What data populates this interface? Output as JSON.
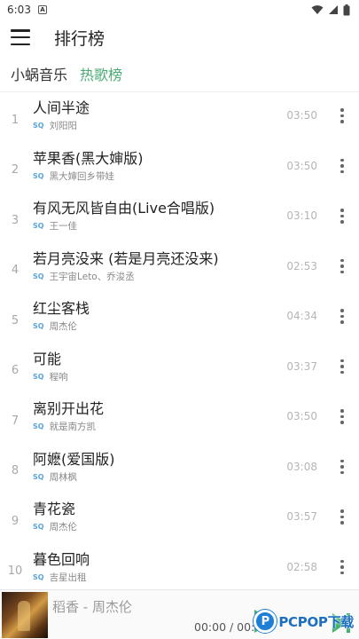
{
  "status_bar": {
    "time": "6:03",
    "notification_icon": "a-badge-icon",
    "icons": [
      "wifi-icon",
      "signal-icon",
      "battery-icon"
    ]
  },
  "app_bar": {
    "menu_icon": "menu-icon",
    "title": "排行榜"
  },
  "tabs": [
    {
      "label": "小蜗音乐",
      "active": false
    },
    {
      "label": "热歌榜",
      "active": true
    }
  ],
  "songs": [
    {
      "rank": "1",
      "title": "人间半途",
      "quality": "SQ",
      "artist": "刘阳阳",
      "duration": "03:50"
    },
    {
      "rank": "2",
      "title": "苹果香(黑大婶版)",
      "quality": "SQ",
      "artist": "黑大婶回乡带娃",
      "duration": "03:50"
    },
    {
      "rank": "3",
      "title": "有风无风皆自由(Live合唱版)",
      "quality": "SQ",
      "artist": "王一佳",
      "duration": "03:10"
    },
    {
      "rank": "4",
      "title": "若月亮没来 (若是月亮还没来)",
      "quality": "SQ",
      "artist": "王宇宙Leto、乔浚丞",
      "duration": "02:53"
    },
    {
      "rank": "5",
      "title": "红尘客栈",
      "quality": "SQ",
      "artist": "周杰伦",
      "duration": "04:34"
    },
    {
      "rank": "6",
      "title": "可能",
      "quality": "SQ",
      "artist": "程响",
      "duration": "03:37"
    },
    {
      "rank": "7",
      "title": "离别开出花",
      "quality": "SQ",
      "artist": "就是南方凯",
      "duration": "03:50"
    },
    {
      "rank": "8",
      "title": "阿嬷(爱国版)",
      "quality": "SQ",
      "artist": "周林枫",
      "duration": "03:08"
    },
    {
      "rank": "9",
      "title": "青花瓷",
      "quality": "SQ",
      "artist": "周杰伦",
      "duration": "03:57"
    },
    {
      "rank": "10",
      "title": "暮色回响",
      "quality": "SQ",
      "artist": "吉星出租",
      "duration": "02:58"
    }
  ],
  "player": {
    "now_playing": "稻香 - 周杰伦",
    "time": "00:00 / 00:00",
    "play_icon": "play-icon",
    "next_icon": "skip-next-icon"
  },
  "watermark": {
    "logo_letter": "P",
    "text": "PCPOP下载"
  },
  "colors": {
    "accent": "#4aaa73",
    "sq_badge": "#5aa5d8",
    "watermark": "#1e6fc0"
  }
}
